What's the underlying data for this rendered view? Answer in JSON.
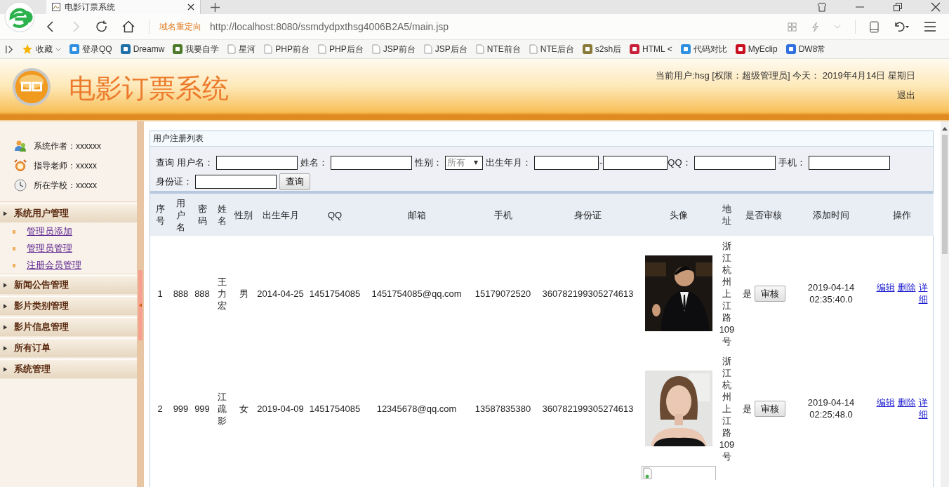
{
  "browser": {
    "tabs": [
      {
        "title": "电影订票系统",
        "selected": true
      }
    ],
    "redirect_label": "域名重定向",
    "url": "http://localhost:8080/ssmdydpxthsg4006B2A5/main.jsp",
    "bookmarks": [
      {
        "kind": "star",
        "label": "收藏",
        "color": "#f5b400"
      },
      {
        "kind": "app",
        "label": "登录QQ",
        "color": "#2f8fe0"
      },
      {
        "kind": "app",
        "label": "Dreamw",
        "color": "#1f6fa8"
      },
      {
        "kind": "app",
        "label": "我要自学",
        "color": "#4d7a2a"
      },
      {
        "kind": "page",
        "label": "星河"
      },
      {
        "kind": "page",
        "label": "PHP前台"
      },
      {
        "kind": "page",
        "label": "PHP后台"
      },
      {
        "kind": "page",
        "label": "JSP前台"
      },
      {
        "kind": "page",
        "label": "JSP后台"
      },
      {
        "kind": "page",
        "label": "NTE前台"
      },
      {
        "kind": "page",
        "label": "NTE后台"
      },
      {
        "kind": "app",
        "label": "s2sh后",
        "color": "#8a7a3a"
      },
      {
        "kind": "app",
        "label": "HTML <",
        "color": "#c8203a"
      },
      {
        "kind": "app",
        "label": "代码对比",
        "color": "#2f8fe0"
      },
      {
        "kind": "app",
        "label": "MyEclip",
        "color": "#c81020"
      },
      {
        "kind": "app",
        "label": "DW8常",
        "color": "#2f6fe0"
      }
    ]
  },
  "header": {
    "title": "电影订票系统",
    "user_info": "当前用户:hsg [权限：超级管理员] 今天： 2019年4月14日 星期日",
    "logout": "退出"
  },
  "sidebar": {
    "info": [
      {
        "kind": "people",
        "text": "系统作者：xxxxxx"
      },
      {
        "kind": "alarm",
        "text": "指导老师：xxxxx"
      },
      {
        "kind": "clock",
        "text": "所在学校：xxxxx"
      }
    ],
    "menu": [
      {
        "label": "系统用户管理",
        "expanded": true,
        "children": [
          {
            "label": "管理员添加"
          },
          {
            "label": "管理员管理"
          },
          {
            "label": "注册会员管理"
          }
        ]
      },
      {
        "label": "新闻公告管理",
        "expanded": false
      },
      {
        "label": "影片类别管理",
        "expanded": false
      },
      {
        "label": "影片信息管理",
        "expanded": false
      },
      {
        "label": "所有订单",
        "expanded": false
      },
      {
        "label": "系统管理",
        "expanded": false
      }
    ]
  },
  "panel": {
    "title": "用户注册列表",
    "search": {
      "lead": "查询",
      "fields": [
        {
          "kind": "text",
          "label": "用户名："
        },
        {
          "kind": "text",
          "label": "姓名："
        },
        {
          "kind": "select",
          "label": "性别：",
          "value": "所有"
        },
        {
          "kind": "range",
          "label": "出生年月：",
          "separator": "-"
        },
        {
          "kind": "text",
          "label": "QQ："
        },
        {
          "kind": "text",
          "label": "手机："
        },
        {
          "kind": "text",
          "label": "身份证："
        }
      ],
      "button": "查询"
    },
    "table": {
      "columns": [
        "序号",
        "用户名",
        "密码",
        "姓名",
        "性别",
        "出生年月",
        "QQ",
        "邮箱",
        "手机",
        "身份证",
        "头像",
        "地址",
        "是否审核",
        "添加时间",
        "操作"
      ],
      "rows": [
        {
          "no": "1",
          "username": "888",
          "password": "888",
          "name": "王力宏",
          "sex": "男",
          "birth": "2014-04-25",
          "qq": "1451754085",
          "email": "1451754085@qq.com",
          "phone": "15179072520",
          "id_card": "360782199305274613",
          "address": "浙江杭州上江路109号",
          "approved": "是",
          "approve_button": "审核",
          "added": "2019-04-14 02:35:40.0",
          "actions": [
            "编辑",
            "删除",
            "详细"
          ]
        },
        {
          "no": "2",
          "username": "999",
          "password": "999",
          "name": "江疏影",
          "sex": "女",
          "birth": "2019-04-09",
          "qq": "1451754085",
          "email": "12345678@qq.com",
          "phone": "13587835380",
          "id_card": "360782199305274613",
          "address": "浙江杭州上江路109号",
          "approved": "是",
          "approve_button": "审核",
          "added": "2019-04-14 02:25:48.0",
          "actions": [
            "编辑",
            "删除",
            "详细"
          ]
        },
        {
          "avatar": {
            "kind": "broken"
          }
        }
      ]
    }
  }
}
